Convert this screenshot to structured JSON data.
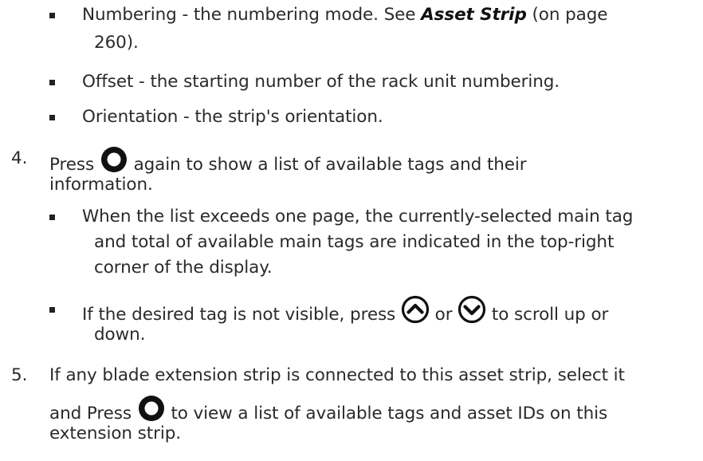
{
  "bullets_top": [
    {
      "prefix": "Numbering - the numbering mode. See ",
      "link": "Asset Strip",
      "suffix": " (on page",
      "line2": "260)."
    },
    {
      "text": "Offset - the starting number of the rack unit numbering."
    },
    {
      "text": "Orientation - the strip's orientation."
    }
  ],
  "steps": [
    {
      "number": "4.",
      "before": "Press",
      "after": "again to show a list of available tags and their",
      "line2": "information."
    },
    {
      "number": "5.",
      "line1": "If any blade extension strip is connected to this asset strip, select it",
      "before": "and Press",
      "after": "to view a list of available tags and asset IDs on this",
      "line3": "extension strip."
    }
  ],
  "step4_bullets": [
    {
      "lines": [
        "When the list exceeds one page, the currently-selected main tag",
        "and total of available main tags are indicated in the top-right",
        "corner of the display."
      ]
    },
    {
      "before": "If the desired tag is not visible, press",
      "middle": "or",
      "after": "to scroll up or",
      "line2": "down."
    }
  ],
  "icons": {
    "select": "select-button-icon",
    "up": "up-arrow-button-icon",
    "down": "down-arrow-button-icon"
  }
}
